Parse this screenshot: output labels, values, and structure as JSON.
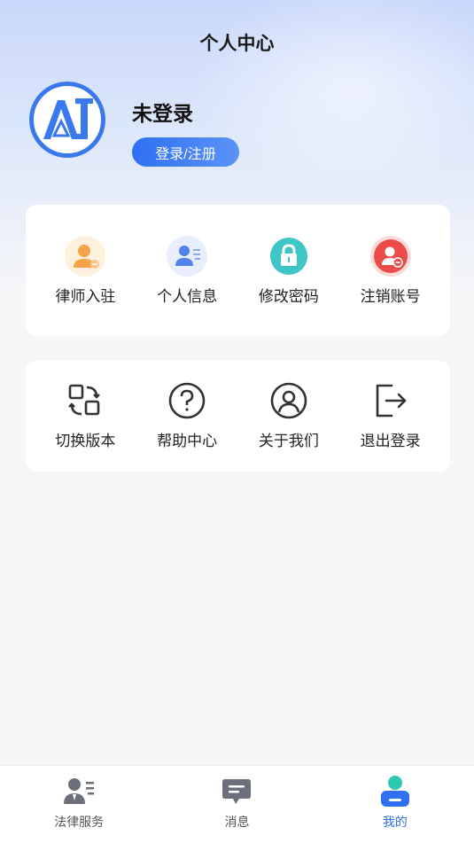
{
  "header": {
    "title": "个人中心"
  },
  "profile": {
    "avatar_icon": "app-logo-icon",
    "username": "未登录",
    "login_label": "登录/注册"
  },
  "menu_primary": [
    {
      "label": "律师入驻",
      "icon": "lawyer-join-icon"
    },
    {
      "label": "个人信息",
      "icon": "personal-info-icon"
    },
    {
      "label": "修改密码",
      "icon": "lock-icon"
    },
    {
      "label": "注销账号",
      "icon": "delete-account-icon"
    }
  ],
  "menu_secondary": [
    {
      "label": "切换版本",
      "icon": "switch-version-icon"
    },
    {
      "label": "帮助中心",
      "icon": "help-icon"
    },
    {
      "label": "关于我们",
      "icon": "user-circle-icon"
    },
    {
      "label": "退出登录",
      "icon": "logout-icon"
    }
  ],
  "tabbar": {
    "active_color": "#2f6ff2",
    "items": [
      {
        "label": "法律服务",
        "icon": "legal-service-icon",
        "active": false
      },
      {
        "label": "消息",
        "icon": "message-icon",
        "active": false
      },
      {
        "label": "我的",
        "icon": "profile-tab-icon",
        "active": true
      }
    ]
  }
}
